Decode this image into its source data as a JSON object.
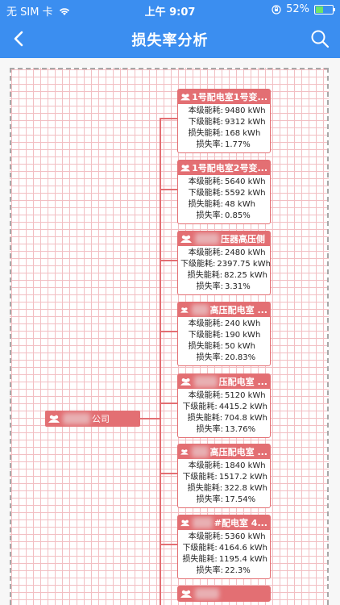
{
  "status": {
    "carrier": "无 SIM 卡",
    "time": "上午 9:07",
    "battery": "52%",
    "battery_level": 0.52
  },
  "nav": {
    "title": "损失率分析",
    "back_icon": "chevron-left-icon",
    "search_icon": "search-icon"
  },
  "colors": {
    "primary": "#3b8ef0",
    "node": "#e36f73",
    "grid": "#f2bfc3"
  },
  "tree": {
    "root": {
      "label": "公司"
    },
    "labels": {
      "self": "本级能耗:",
      "lower": "下级能耗:",
      "loss": "损失能耗:",
      "rate": "损失率:"
    },
    "nodes": [
      {
        "title": "1号配电室1号变...",
        "self": "9480 kWh",
        "lower": "9312 kWh",
        "loss": "168 kWh",
        "rate": "1.77%"
      },
      {
        "title": "1号配电室2号变...",
        "self": "5640 kWh",
        "lower": "5592 kWh",
        "loss": "48 kWh",
        "rate": "0.85%"
      },
      {
        "title": "压器高压侧",
        "self": "2480 kWh",
        "lower": "2397.75 kWh",
        "loss": "82.25 kWh",
        "rate": "3.31%"
      },
      {
        "title": "高压配电室 ...",
        "self": "240 kWh",
        "lower": "190 kWh",
        "loss": "50 kWh",
        "rate": "20.83%"
      },
      {
        "title": "压配电室 ...",
        "self": "5120 kWh",
        "lower": "4415.2 kWh",
        "loss": "704.8 kWh",
        "rate": "13.76%"
      },
      {
        "title": "高压配电室 ...",
        "self": "1840 kWh",
        "lower": "1517.2 kWh",
        "loss": "322.8 kWh",
        "rate": "17.54%"
      },
      {
        "title": "#配电室 4...",
        "self": "5360 kWh",
        "lower": "4164.6 kWh",
        "loss": "1195.4 kWh",
        "rate": "22.3%"
      },
      {
        "title": "",
        "self": "",
        "lower": "",
        "loss": "",
        "rate": ""
      }
    ]
  }
}
